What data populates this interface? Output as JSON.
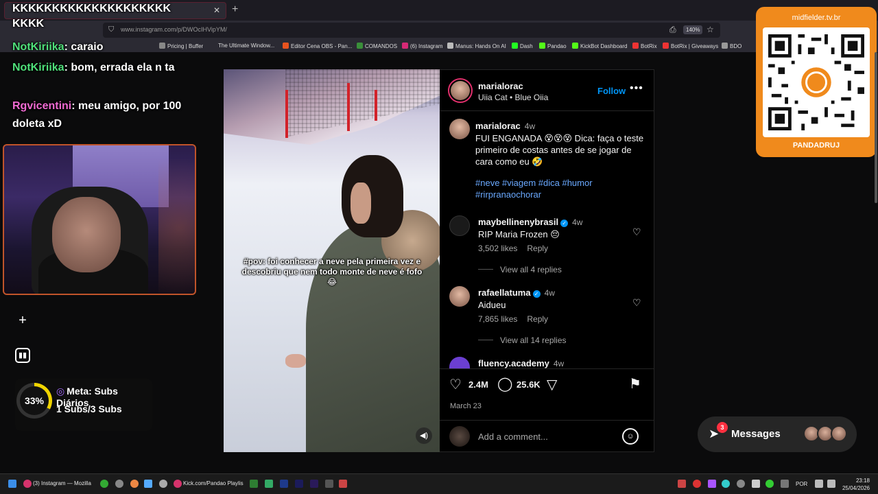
{
  "browser": {
    "tab_title": "KKKKKKKKKKKKKKKKKKKK",
    "tab_title_2": "KKKK",
    "url": "www.instagram.com/p/DWOcIHVipYM/",
    "zoom": "140%",
    "bookmarks": [
      "Pricing | Buffer",
      "The Ultimate Window...",
      "Editor Cena OBS - Pan...",
      "COMANDOS",
      "(6) Instagram",
      "Manus: Hands On AI",
      "Dash",
      "Pandao",
      "KickBot Dashboard",
      "BotRix",
      "BotRix | Giveaways",
      "BDO"
    ]
  },
  "chat": [
    {
      "user": "NotKiriika",
      "text": ": caraio"
    },
    {
      "user": "NotKiriika",
      "text": ": bom, errada ela n ta"
    },
    {
      "user": "Rgvicentini",
      "text": ": meu amigo, por 100 doleta xD"
    }
  ],
  "goal": {
    "percent_label": "33%",
    "title": "Meta: Subs Diários",
    "progress": "1 Subs/3 Subs"
  },
  "post": {
    "username": "marialorac",
    "audio": "Uiia Cat • Blue Oiia",
    "follow": "Follow",
    "overlay_text": "#pov: foi conhecer a neve pela primeira vez e descobriu que nem todo monte de neve é fofo 😂",
    "caption_user": "marialorac",
    "caption_ago": "4w",
    "caption": "FUI ENGANADA 😵😵😵 Dica: faça o teste primeiro de costas antes de se jogar de cara como eu 🤣",
    "hashtags": "#neve #viagem #dica #humor #rirpranaochorar",
    "comments": [
      {
        "user": "maybellinenybrasil",
        "ago": "4w",
        "text": "RIP Maria Frozen 😔",
        "likes": "3,502 likes",
        "reply": "Reply",
        "view_replies": "View all 4 replies"
      },
      {
        "user": "rafaellatuma",
        "ago": "4w",
        "text": "Aidueu",
        "likes": "7,865 likes",
        "reply": "Reply",
        "view_replies": "View all 14 replies"
      },
      {
        "user": "fluency.academy",
        "ago": "4w"
      }
    ],
    "likes_count": "2.4M",
    "comments_count": "25.6K",
    "date": "March 23",
    "comment_placeholder": "Add a comment..."
  },
  "messages": {
    "label": "Messages",
    "badge": "3"
  },
  "qr": {
    "url": "midfielder.tv.br",
    "name": "PANDADRUJ"
  },
  "taskbar": {
    "app1": "(3) Instagram — Mozilla",
    "app2": "Kick.com/Pandao Playlis",
    "lang": "POR",
    "time": "23:18",
    "date": "25/04/2026"
  }
}
